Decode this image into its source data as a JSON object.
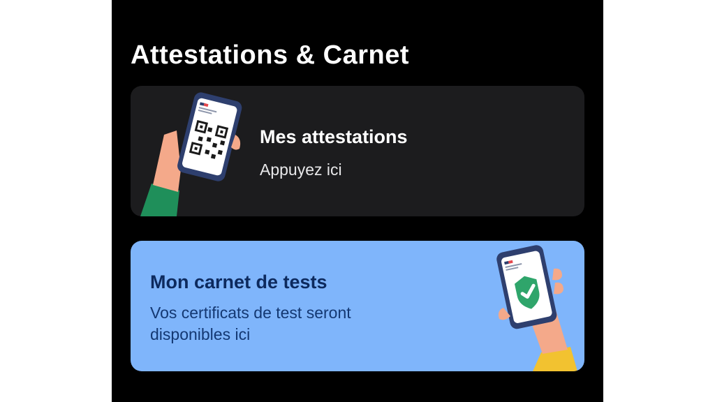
{
  "section": {
    "title": "Attestations & Carnet"
  },
  "cards": {
    "attestations": {
      "title": "Mes attestations",
      "subtitle": "Appuyez ici",
      "icon": "phone-qr-code-illustration"
    },
    "carnet": {
      "title": "Mon carnet de tests",
      "subtitle": "Vos certificats de test seront disponibles ici",
      "icon": "phone-check-illustration"
    }
  },
  "colors": {
    "background": "#000000",
    "card_dark": "#1c1c1e",
    "card_blue": "#7fb5fb",
    "check_green": "#2fa56b",
    "sleeve_green": "#1f8f5a",
    "sleeve_yellow": "#f2c230",
    "skin": "#f4a98a",
    "phone_frame": "#2e3f6e"
  }
}
